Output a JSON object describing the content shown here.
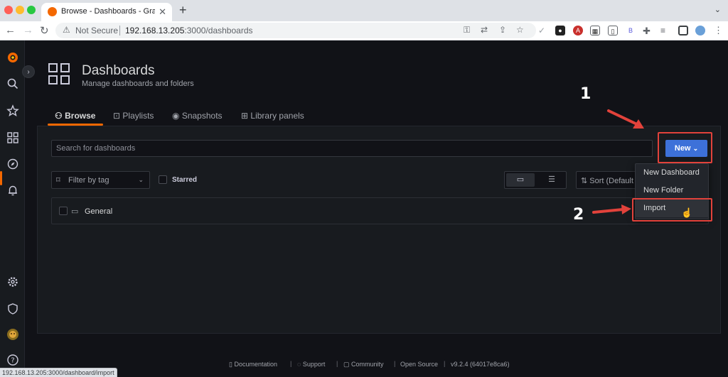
{
  "browser": {
    "tab_title": "Browse - Dashboards - Grafana",
    "security_label": "Not Secure",
    "url_host": "192.168.13.205",
    "url_rest": ":3000/dashboards",
    "status_url": "192.168.13.205:3000/dashboard/import",
    "extensions": [
      "key-icon",
      "translate-icon",
      "share-icon",
      "bookmark-star-icon",
      "check-icon",
      "cat-extension-icon",
      "abp-icon",
      "qr-icon",
      "shield-extension-icon",
      "b-extension-icon",
      "puzzle-icon",
      "playlist-icon",
      "sidepanel-icon",
      "avatar-icon",
      "menu-dots-icon"
    ]
  },
  "header": {
    "title": "Dashboards",
    "subtitle": "Manage dashboards and folders"
  },
  "tabs": [
    {
      "label": "Browse",
      "icon": "sitemap-icon",
      "active": true
    },
    {
      "label": "Playlists",
      "icon": "presentation-icon",
      "active": false
    },
    {
      "label": "Snapshots",
      "icon": "camera-icon",
      "active": false
    },
    {
      "label": "Library panels",
      "icon": "library-panel-icon",
      "active": false
    }
  ],
  "search": {
    "placeholder": "Search for dashboards"
  },
  "new_button": {
    "label": "New",
    "chevron": "⌄"
  },
  "filter": {
    "label": "Filter by tag"
  },
  "starred": {
    "label": "Starred"
  },
  "sort": {
    "label": "Sort (Default A-Z)"
  },
  "folders": [
    {
      "label": "General"
    }
  ],
  "new_menu": [
    {
      "label": "New Dashboard"
    },
    {
      "label": "New Folder"
    },
    {
      "label": "Import"
    }
  ],
  "annotations": {
    "step1": "1",
    "step2": "2",
    "color": "#e2423b"
  },
  "footer": {
    "documentation": "Documentation",
    "support": "Support",
    "community": "Community",
    "open_source": "Open Source",
    "version": "v9.2.4 (64017e8ca6)"
  },
  "colors": {
    "accent": "#f46800",
    "primary_button": "#3d71d9",
    "background": "#111217"
  }
}
